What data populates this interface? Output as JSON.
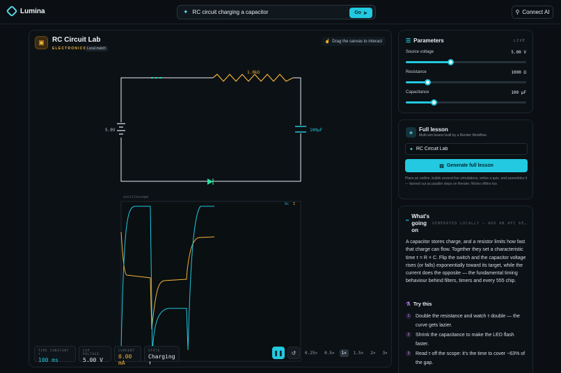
{
  "app": {
    "name": "Lumina"
  },
  "search": {
    "value": "RC circuit charging a capacitor",
    "go_label": "Go"
  },
  "connect_label": "Connect AI",
  "lab": {
    "title": "RC Circuit Lab",
    "category": "ELECTRONICS",
    "badge": "Local match",
    "drag_hint": "Drag the canvas to interact"
  },
  "circuit": {
    "resistor_label": "1.0kΩ",
    "battery_label": "5.0V",
    "capacitor_label": "100µF",
    "scope_label": "oscilloscope",
    "scope_vc": "Vc",
    "scope_i": "I"
  },
  "stats": [
    {
      "label": "TIME CONSTANT τ",
      "value": "100 ms",
      "color": "#22c9e0"
    },
    {
      "label": "CAP VOLTAGE",
      "value": "5.00 V",
      "color": "#e6edf3"
    },
    {
      "label": "CURRENT",
      "value": "0.00 mA",
      "color": "#f2b43a"
    },
    {
      "label": "STATE",
      "value": "Charging ↑",
      "color": "#e6edf3"
    }
  ],
  "speeds": [
    "0.25×",
    "0.5×",
    "1×",
    "1.5×",
    "2×",
    "3×"
  ],
  "active_speed": "1×",
  "parameters": {
    "title": "Parameters",
    "status": "LIVE",
    "items": [
      {
        "label": "Source voltage",
        "value": "5.00 V",
        "fraction": 0.37
      },
      {
        "label": "Resistance",
        "value": "1000 Ω",
        "fraction": 0.18
      },
      {
        "label": "Capacitance",
        "value": "100 µF",
        "fraction": 0.23
      }
    ]
  },
  "lesson": {
    "title": "Full lesson",
    "subtitle": "Multi-sim lesson built by a Render Workflow",
    "input_value": "RC Circuit Lab",
    "button_label": "Generate full lesson",
    "note": "Plans an outline, builds several live simulations, writes a quiz, and assembles it — fanned out as parallel steps on Render. Works offline too."
  },
  "going_on": {
    "title": "What's going on",
    "meta": "GENERATED LOCALLY — ADD AN API KE…",
    "body": "A capacitor stores charge, and a resistor limits how fast that charge can flow. Together they set a characteristic time τ = R × C. Flip the switch and the capacitor voltage rises (or falls) exponentially toward its target, while the current does the opposite — the fundamental timing behaviour behind filters, timers and every 555 chip.",
    "try_title": "Try this",
    "tries": [
      "Double the resistance and watch τ double — the curve gets lazier.",
      "Shrink the capacitance to make the LED flash faster.",
      "Read τ off the scope: it's the time to cover ~63% of the gap."
    ]
  },
  "colors": {
    "accent": "#22c9e0",
    "current": "#f2b43a",
    "wire": "#e6edf3"
  }
}
